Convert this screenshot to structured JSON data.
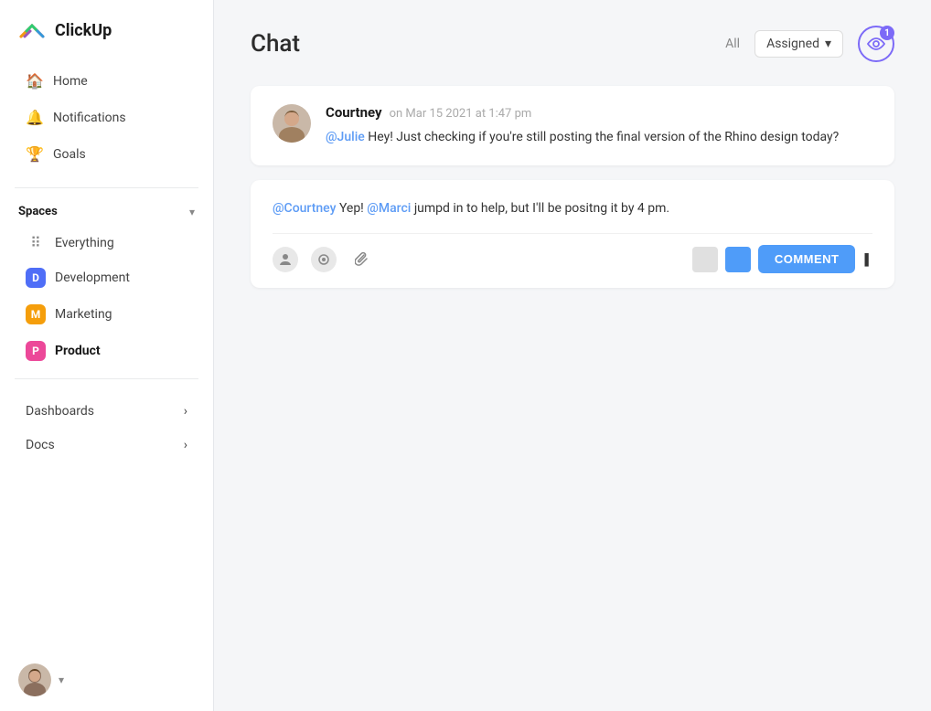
{
  "app": {
    "name": "ClickUp"
  },
  "sidebar": {
    "nav": [
      {
        "id": "home",
        "label": "Home",
        "icon": "🏠"
      },
      {
        "id": "notifications",
        "label": "Notifications",
        "icon": "🔔"
      },
      {
        "id": "goals",
        "label": "Goals",
        "icon": "🏆"
      }
    ],
    "spaces_label": "Spaces",
    "spaces": [
      {
        "id": "everything",
        "label": "Everything",
        "type": "dots"
      },
      {
        "id": "development",
        "label": "Development",
        "type": "badge",
        "badge": "D",
        "color": "dev"
      },
      {
        "id": "marketing",
        "label": "Marketing",
        "type": "badge",
        "badge": "M",
        "color": "marketing"
      },
      {
        "id": "product",
        "label": "Product",
        "type": "badge",
        "badge": "P",
        "color": "product",
        "active": true
      }
    ],
    "bottom_nav": [
      {
        "id": "dashboards",
        "label": "Dashboards"
      },
      {
        "id": "docs",
        "label": "Docs"
      }
    ]
  },
  "main": {
    "title": "Chat",
    "filter_all": "All",
    "filter_assigned": "Assigned",
    "notification_count": "1"
  },
  "messages": [
    {
      "id": "msg1",
      "author": "Courtney",
      "timestamp": "on Mar 15 2021 at 1:47 pm",
      "mention": "@Julie",
      "text": " Hey! Just checking if you're still posting the final version of the Rhino design today?"
    }
  ],
  "reply": {
    "mention1": "@Courtney",
    "mention2": "@Marci",
    "text_before": " Yep! ",
    "text_after": " jumpd in to help, but I'll be positng it by 4 pm.",
    "comment_button": "COMMENT"
  },
  "icons": {
    "eye": "👁",
    "person": "👤",
    "circle": "⬤",
    "paperclip": "📎",
    "chevron_down": "▾"
  }
}
